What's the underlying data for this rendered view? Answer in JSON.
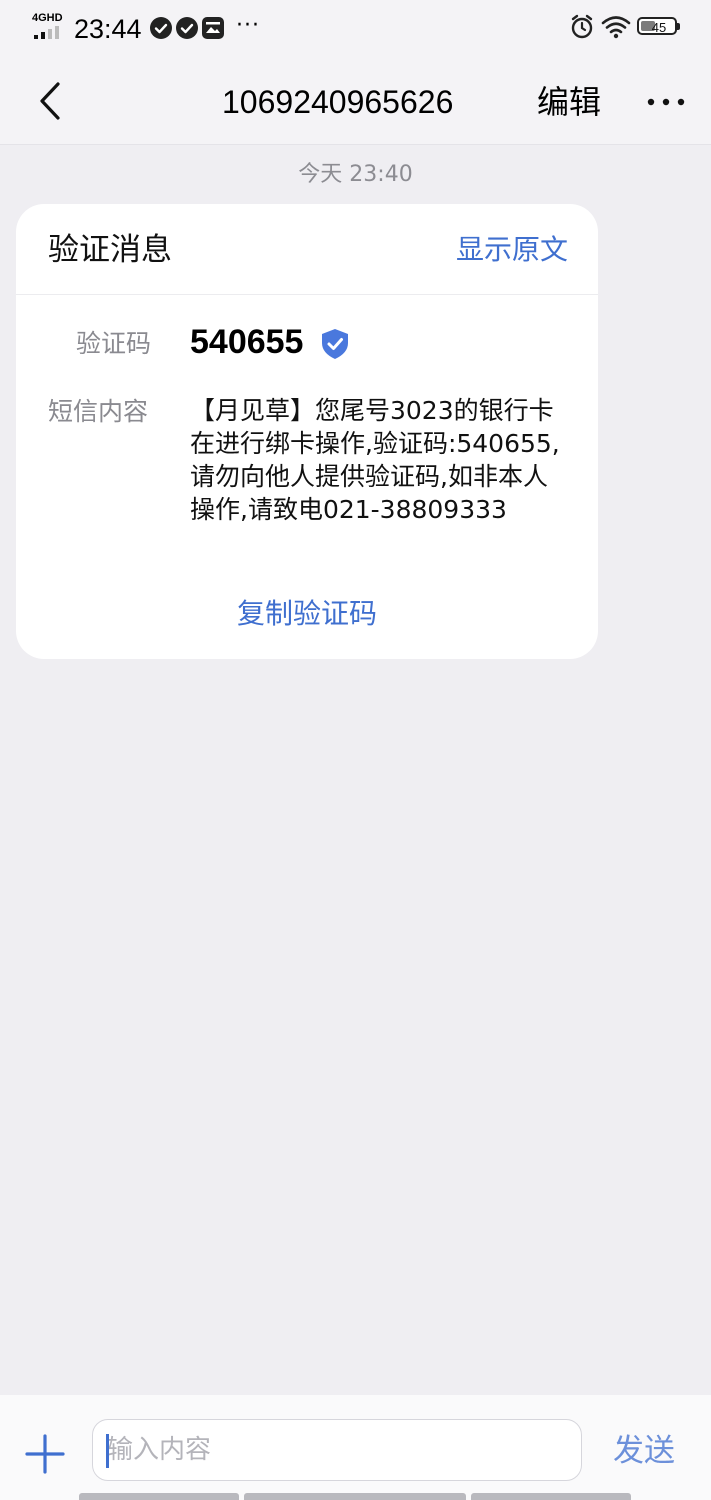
{
  "status_bar": {
    "network": "4GHD",
    "time": "23:44",
    "more_notifications": "···",
    "battery": 45,
    "icons": [
      "check-circle-icon",
      "check-circle-icon",
      "image-notification-icon",
      "alarm-icon",
      "wifi-icon",
      "battery-icon"
    ]
  },
  "header": {
    "title": "1069240965626",
    "edit_label": "编辑",
    "icons": [
      "chevron-left-icon",
      "more-dots-icon"
    ]
  },
  "conversation": {
    "timestamp": "今天 23:40",
    "card": {
      "title": "验证消息",
      "show_original": "显示原文",
      "code_label": "验证码",
      "code_value": "540655",
      "content_label": "短信内容",
      "content_text": "【月见草】您尾号3023的银行卡在进行绑卡操作,验证码:540655,请勿向他人提供验证码,如非本人操作,请致电021-38809333",
      "copy_code": "复制验证码",
      "verified_icon": "verified-shield-icon"
    }
  },
  "composer": {
    "placeholder": "输入内容",
    "send_label": "发送",
    "add_icon": "plus-icon"
  },
  "colors": {
    "accent": "#3f6fcf",
    "send": "#6c90da",
    "background": "#efeef2",
    "card": "#ffffff"
  }
}
